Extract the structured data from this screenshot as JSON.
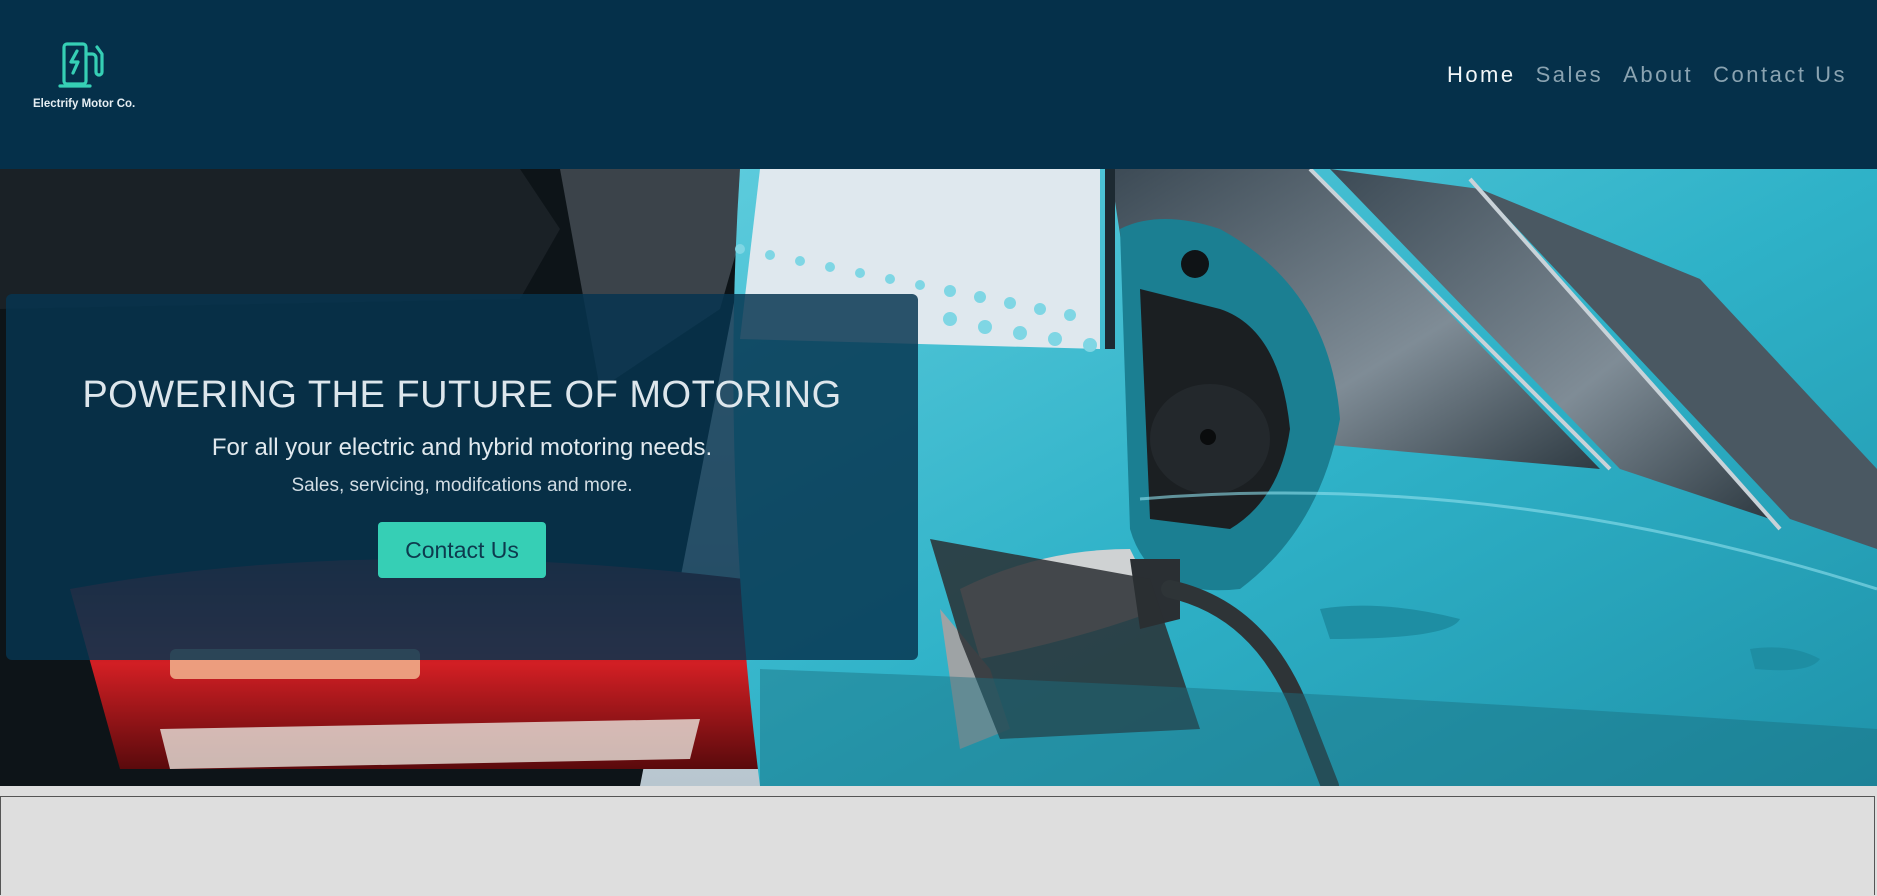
{
  "brand": {
    "name": "Electrify Motor Co.",
    "accent": "#36cfb5",
    "header_bg": "#05304a"
  },
  "nav": {
    "items": [
      {
        "label": "Home",
        "active": true
      },
      {
        "label": "Sales",
        "active": false
      },
      {
        "label": "About",
        "active": false
      },
      {
        "label": "Contact Us",
        "active": false
      }
    ]
  },
  "hero": {
    "title": "POWERING THE FUTURE OF MOTORING",
    "subtitle": "For all your electric and hybrid motoring needs.",
    "tagline": "Sales, servicing, modifcations and more.",
    "cta_label": "Contact Us",
    "image_icon": "car-charging-photo"
  },
  "icons": {
    "logo": "ev-charger-icon"
  }
}
